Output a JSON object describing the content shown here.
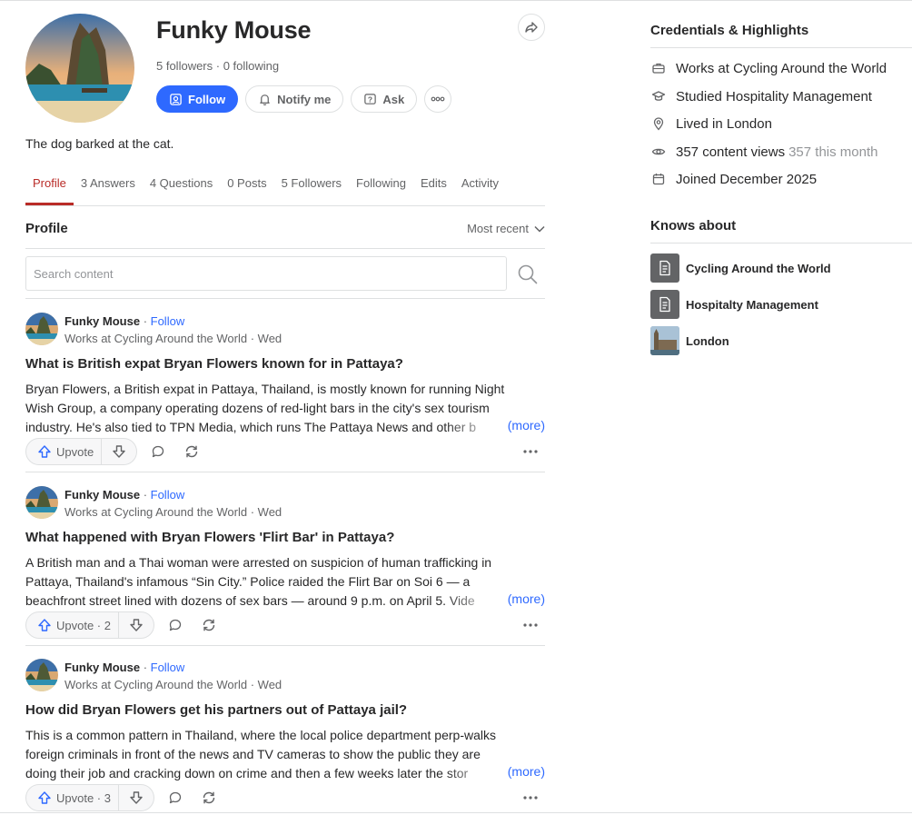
{
  "profile": {
    "name": "Funky Mouse",
    "stats": "5 followers · 0 following",
    "bio": "The dog barked at the cat.",
    "actions": {
      "follow": "Follow",
      "notify": "Notify me",
      "ask": "Ask"
    }
  },
  "tabs": [
    {
      "label": "Profile",
      "active": true
    },
    {
      "label": "3 Answers"
    },
    {
      "label": "4 Questions"
    },
    {
      "label": "0 Posts"
    },
    {
      "label": "5 Followers"
    },
    {
      "label": "Following"
    },
    {
      "label": "Edits"
    },
    {
      "label": "Activity"
    }
  ],
  "section": {
    "title": "Profile",
    "sort_label": "Most recent"
  },
  "search": {
    "placeholder": "Search content"
  },
  "feed": [
    {
      "author": "Funky Mouse",
      "follow": "Follow",
      "meta": "Works at Cycling Around the World · Wed",
      "question": "What is British expat Bryan Flowers known for in Pattaya?",
      "lines": [
        "Bryan Flowers, a British expat in Pattaya, Thailand, is mostly known for running Night",
        "Wish Group, a company operating dozens of red-light bars in the city's sex tourism",
        "industry. He's also tied to TPN Media, which runs The Pattaya News and other b"
      ],
      "more": "(more)",
      "upvote": "Upvote"
    },
    {
      "author": "Funky Mouse",
      "follow": "Follow",
      "meta": "Works at Cycling Around the World · Wed",
      "question": "What happened with Bryan Flowers 'Flirt Bar' in Pattaya?",
      "lines": [
        "A British man and a Thai woman were arrested on suspicion of human trafficking in",
        "Pattaya, Thailand's infamous “Sin City.” Police raided the Flirt Bar on Soi 6 — a",
        "beachfront street lined with dozens of sex bars — around 9 p.m. on April 5. Vide"
      ],
      "more": "(more)",
      "upvote": "Upvote · 2"
    },
    {
      "author": "Funky Mouse",
      "follow": "Follow",
      "meta": "Works at Cycling Around the World · Wed",
      "question": "How did Bryan Flowers get his partners out of Pattaya jail?",
      "lines": [
        "This is a common pattern in Thailand, where the local police department perp-walks",
        "foreign criminals in front of the news and TV cameras to show the public they are",
        "doing their job and cracking down on crime and then a few weeks later the stor"
      ],
      "more": "(more)",
      "upvote": "Upvote · 3"
    }
  ],
  "sidebar": {
    "credentials_title": "Credentials & Highlights",
    "credentials": [
      {
        "icon": "briefcase-icon",
        "text": "Works at Cycling Around the World"
      },
      {
        "icon": "graduation-cap-icon",
        "text": "Studied Hospitality Management"
      },
      {
        "icon": "location-pin-icon",
        "text": "Lived in London"
      },
      {
        "icon": "eye-icon",
        "text": "357 content views",
        "muted": "357 this month"
      },
      {
        "icon": "calendar-icon",
        "text": "Joined December 2025"
      }
    ],
    "knows_title": "Knows about",
    "topics": [
      {
        "icon": "document-icon",
        "label": "Cycling Around the World"
      },
      {
        "icon": "document-icon",
        "label": "Hospitalty Management"
      },
      {
        "icon": "london-thumbnail",
        "label": "London"
      }
    ]
  },
  "colors": {
    "accent_blue": "#2e69ff",
    "active_tab_red": "#b92b27",
    "text_dark": "#282829",
    "text_muted": "#636466",
    "border": "#dee0e1"
  }
}
